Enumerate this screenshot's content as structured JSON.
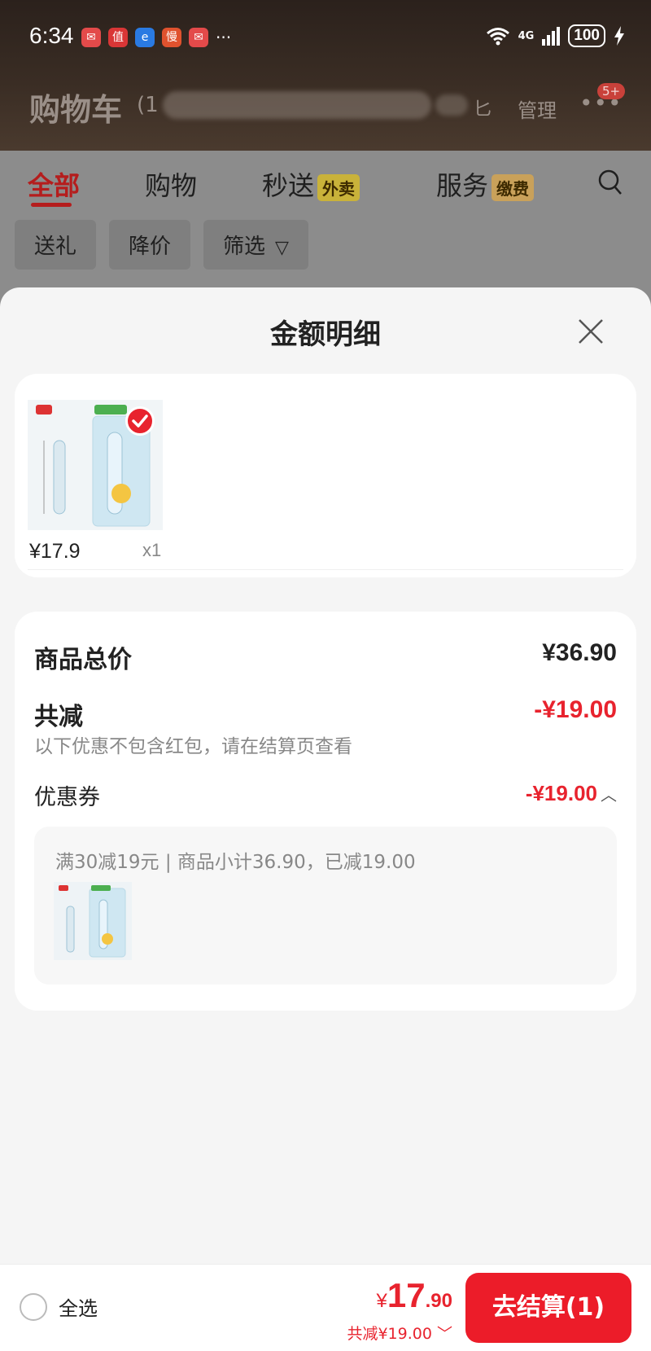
{
  "status_bar": {
    "time": "6:34",
    "more": "···",
    "network": "4G",
    "battery": "100"
  },
  "header": {
    "title": "购物车",
    "count_prefix": "(1",
    "suffix_visible": "匕",
    "manage": "管理",
    "badge": "5+"
  },
  "tabs": [
    {
      "label": "全部",
      "active": true
    },
    {
      "label": "购物"
    },
    {
      "label": "秒送",
      "tag": "外卖"
    },
    {
      "label": "服务",
      "tag": "缴费"
    }
  ],
  "filters": [
    "送礼",
    "降价",
    "筛选"
  ],
  "sheet": {
    "title": "金额明细",
    "product": {
      "price": "¥17.9",
      "qty": "x1"
    },
    "summary": {
      "total_label": "商品总价",
      "total_value": "¥36.90",
      "discount_label": "共减",
      "discount_value": "-¥19.00",
      "note": "以下优惠不包含红包，请在结算页查看",
      "coupon_label": "优惠券",
      "coupon_value": "-¥19.00",
      "coupon_desc": "满30减19元 | 商品小计36.90，已减19.00"
    }
  },
  "footer": {
    "select_all": "全选",
    "currency": "¥",
    "total_int": "17",
    "total_dec": ".90",
    "saved": "共减¥19.00",
    "checkout": "去结算(1)"
  },
  "colors": {
    "accent": "#e8232e",
    "tab_active": "#b51d1d"
  }
}
